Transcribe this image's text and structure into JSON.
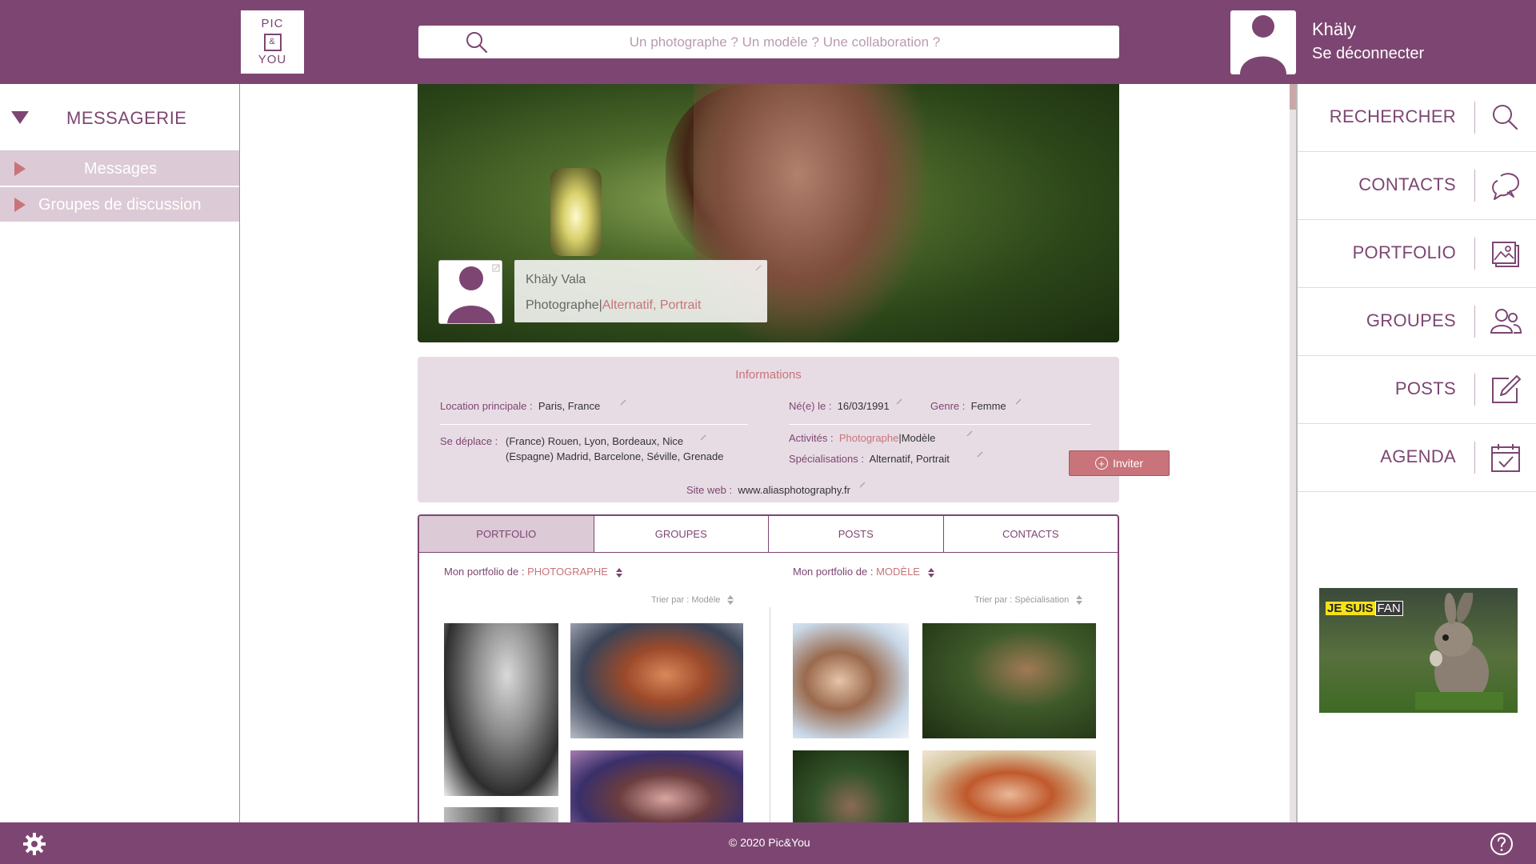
{
  "header": {
    "logo": {
      "line1": "PIC",
      "line2": "&",
      "line3": "YOU"
    },
    "search_placeholder": "Un photographe ? Un modèle ? Une collaboration ?",
    "user_name": "Khäly",
    "logout_label": "Se déconnecter"
  },
  "left_sidebar": {
    "section_title": "MESSAGERIE",
    "items": [
      {
        "label": "Messages"
      },
      {
        "label": "Groupes de discussion"
      }
    ]
  },
  "right_sidebar": {
    "items": [
      {
        "label": "RECHERCHER",
        "icon": "search-icon"
      },
      {
        "label": "CONTACTS",
        "icon": "chat-icon"
      },
      {
        "label": "PORTFOLIO",
        "icon": "image-icon"
      },
      {
        "label": "GROUPES",
        "icon": "users-icon"
      },
      {
        "label": "POSTS",
        "icon": "edit-icon"
      },
      {
        "label": "AGENDA",
        "icon": "calendar-icon"
      }
    ],
    "ad": {
      "part1": "JE SUIS",
      "part2": "FAN"
    }
  },
  "profile": {
    "name": "Khäly Vala",
    "role": "Photographe",
    "separator": "|",
    "specialties": "Alternatif, Portrait"
  },
  "info": {
    "title": "Informations",
    "location_label": "Location principale :",
    "location_value": "Paris, France",
    "birth_label": "Né(e) le :",
    "birth_value": "16/03/1991",
    "gender_label": "Genre :",
    "gender_value": "Femme",
    "travel_label": "Se déplace :",
    "travel_line1": "(France) Rouen, Lyon, Bordeaux, Nice",
    "travel_line2": "(Espagne) Madrid, Barcelone, Séville, Grenade",
    "activities_label": "Activités :",
    "activity_1": "Photographe",
    "activity_sep": "|",
    "activity_2": "Modèle",
    "spec_label": "Spécialisations :",
    "spec_value": "Alternatif, Portrait",
    "website_label": "Site web :",
    "website_value": "www.aliasphotography.fr",
    "invite_label": "Inviter"
  },
  "tabs": [
    {
      "label": "PORTFOLIO",
      "active": true
    },
    {
      "label": "GROUPES",
      "active": false
    },
    {
      "label": "POSTS",
      "active": false
    },
    {
      "label": "CONTACTS",
      "active": false
    }
  ],
  "portfolio": {
    "left_prefix": "Mon portfolio de :",
    "left_value": "PHOTOGRAPHE",
    "left_sort": "Trier par : Modèle",
    "right_prefix": "Mon portfolio de :",
    "right_value": "MODÈLE",
    "right_sort": "Trier par : Spécialisation"
  },
  "footer": {
    "copyright": "© 2020 Pic&You"
  },
  "colors": {
    "brand": "#7d4672",
    "accent": "#c8747a",
    "panel": "#e7dce4",
    "tab_active": "#dccad6"
  }
}
